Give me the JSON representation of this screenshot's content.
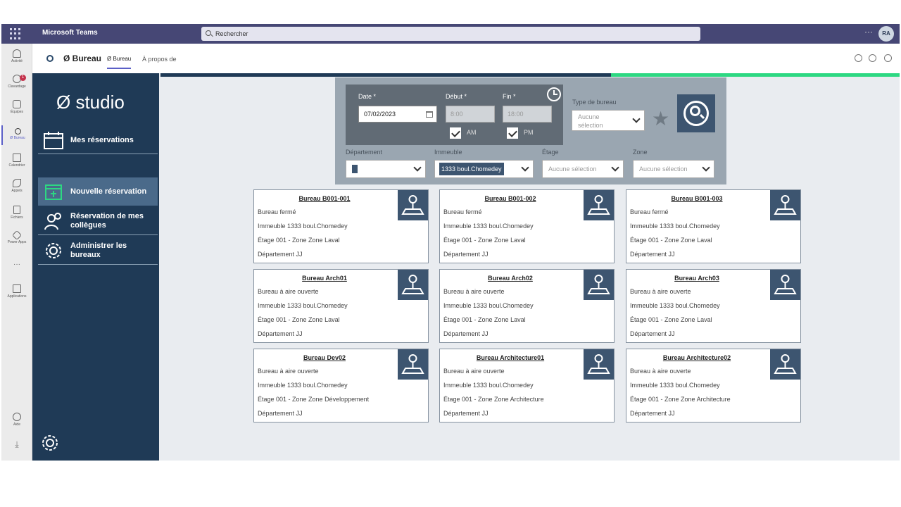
{
  "teams": {
    "title": "Microsoft Teams",
    "search_placeholder": "Rechercher",
    "more": "···",
    "avatar_initials": "RA"
  },
  "rail": {
    "items": [
      {
        "label": "Activité",
        "icon": "bell-icon"
      },
      {
        "label": "Clavardage",
        "icon": "chat-icon",
        "badge": "1"
      },
      {
        "label": "Équipes",
        "icon": "teams-icon"
      },
      {
        "label": "Ø Bureau",
        "icon": "bureau-app-icon"
      },
      {
        "label": "Calendrier",
        "icon": "calendar-icon"
      },
      {
        "label": "Appels",
        "icon": "phone-icon"
      },
      {
        "label": "Fichiers",
        "icon": "file-icon"
      },
      {
        "label": "Power Apps",
        "icon": "power-apps-icon"
      },
      {
        "label": "Applications",
        "icon": "apps-icon"
      },
      {
        "label": "Aide",
        "icon": "help-icon"
      }
    ],
    "more": "···"
  },
  "header": {
    "app_name": "Ø Bureau",
    "tabs": [
      "Ø Bureau",
      "À propos de"
    ]
  },
  "sidebar": {
    "logo": "Ø studio",
    "items": [
      {
        "label": "Mes réservations"
      },
      {
        "label": "Nouvelle réservation"
      },
      {
        "label": "Réservation de mes collègues"
      },
      {
        "label": "Administrer les bureaux"
      }
    ]
  },
  "filters": {
    "date_label": "Date *",
    "date_value": "07/02/2023",
    "start_label": "Début *",
    "start_value": "8:00",
    "end_label": "Fin *",
    "end_value": "18:00",
    "am_label": "AM",
    "pm_label": "PM",
    "type_label": "Type de bureau",
    "type_value": "Aucune sélection",
    "department_label": "Département",
    "building_label": "Immeuble",
    "building_value": "1333 boul.Chomedey",
    "floor_label": "Étage",
    "floor_value": "Aucune sélection",
    "zone_label": "Zone",
    "zone_value": "Aucune sélection"
  },
  "cards": [
    {
      "title": "Bureau B001-001",
      "type": "Bureau fermé",
      "building": "Immeuble 1333 boul.Chomedey",
      "floor": "Étage 001 - Zone Zone Laval",
      "department": "Département JJ"
    },
    {
      "title": "Bureau B001-002",
      "type": "Bureau fermé",
      "building": "Immeuble 1333 boul.Chomedey",
      "floor": "Étage 001 - Zone Zone Laval",
      "department": "Département JJ"
    },
    {
      "title": "Bureau B001-003",
      "type": "Bureau fermé",
      "building": "Immeuble 1333 boul.Chomedey",
      "floor": "Étage 001 - Zone Zone Laval",
      "department": "Département JJ"
    },
    {
      "title": "Bureau Arch01",
      "type": "Bureau à aire ouverte",
      "building": "Immeuble 1333 boul.Chomedey",
      "floor": "Étage 001 - Zone Zone Laval",
      "department": "Département JJ"
    },
    {
      "title": "Bureau Arch02",
      "type": "Bureau à aire ouverte",
      "building": "Immeuble 1333 boul.Chomedey",
      "floor": "Étage 001 - Zone Zone Laval",
      "department": "Département JJ"
    },
    {
      "title": "Bureau Arch03",
      "type": "Bureau à aire ouverte",
      "building": "Immeuble 1333 boul.Chomedey",
      "floor": "Étage 001 - Zone Zone Laval",
      "department": "Département JJ"
    },
    {
      "title": "Bureau Dev02",
      "type": "Bureau à aire ouverte",
      "building": "Immeuble 1333 boul.Chomedey",
      "floor": "Étage 001 - Zone Zone Développement",
      "department": "Département JJ"
    },
    {
      "title": "Bureau Architecture01",
      "type": "Bureau à aire ouverte",
      "building": "Immeuble 1333 boul.Chomedey",
      "floor": "Étage 001 - Zone Zone Architecture",
      "department": "Département JJ"
    },
    {
      "title": "Bureau Architecture02",
      "type": "Bureau à aire ouverte",
      "building": "Immeuble 1333 boul.Chomedey",
      "floor": "Étage 001 - Zone Zone Architecture",
      "department": "Département JJ"
    }
  ],
  "colors": {
    "teams_bar": "#464775",
    "sidebar": "#1f3a56",
    "accent": "#3d5570",
    "progress_green": "#2dd882"
  }
}
